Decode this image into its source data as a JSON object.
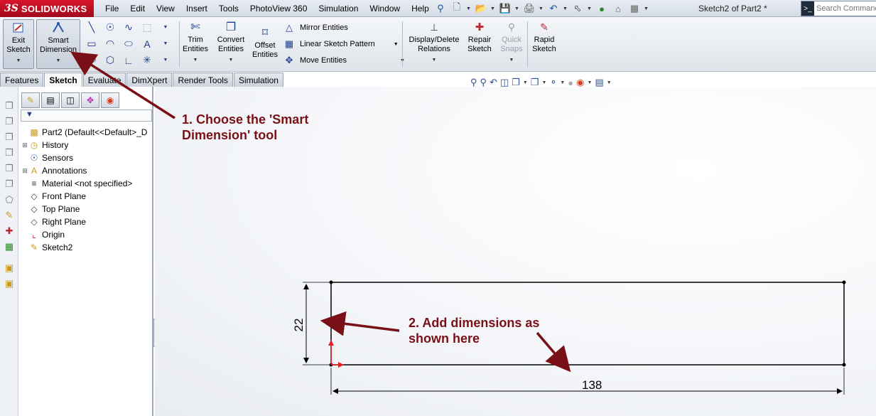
{
  "app": {
    "brand_prefix": "3S",
    "brand": "SOLIDWORKS",
    "doc_title": "Sketch2 of Part2 *"
  },
  "menu": [
    "File",
    "Edit",
    "View",
    "Insert",
    "Tools",
    "PhotoView 360",
    "Simulation",
    "Window",
    "Help"
  ],
  "search": {
    "placeholder": "Search Commands"
  },
  "ribbon": {
    "exit_sketch": [
      "Exit",
      "Sketch"
    ],
    "smart_dimension": [
      "Smart",
      "Dimension"
    ],
    "trim_entities": [
      "Trim",
      "Entities"
    ],
    "convert_entities": [
      "Convert",
      "Entities"
    ],
    "offset_entities": [
      "Offset",
      "Entities"
    ],
    "mirror_entities": "Mirror Entities",
    "linear_sketch_pattern": "Linear Sketch Pattern",
    "move_entities": "Move Entities",
    "display_delete_relations": [
      "Display/Delete",
      "Relations"
    ],
    "repair_sketch": [
      "Repair",
      "Sketch"
    ],
    "quick_snaps": [
      "Quick",
      "Snaps"
    ],
    "rapid_sketch": [
      "Rapid",
      "Sketch"
    ]
  },
  "tabs": [
    "Features",
    "Sketch",
    "Evaluate",
    "DimXpert",
    "Render Tools",
    "Simulation"
  ],
  "active_tab": "Sketch",
  "tree": {
    "root": "Part2  (Default<<Default>_D",
    "items": [
      {
        "label": "History",
        "expandable": true,
        "icon": "history-icon"
      },
      {
        "label": "Sensors",
        "expandable": false,
        "icon": "sensor-icon"
      },
      {
        "label": "Annotations",
        "expandable": true,
        "icon": "annotations-icon"
      },
      {
        "label": "Material <not specified>",
        "expandable": false,
        "icon": "material-icon"
      },
      {
        "label": "Front Plane",
        "expandable": false,
        "icon": "plane-icon"
      },
      {
        "label": "Top Plane",
        "expandable": false,
        "icon": "plane-icon"
      },
      {
        "label": "Right Plane",
        "expandable": false,
        "icon": "plane-icon"
      },
      {
        "label": "Origin",
        "expandable": false,
        "icon": "origin-icon"
      },
      {
        "label": "Sketch2",
        "expandable": false,
        "icon": "sketch-icon"
      }
    ]
  },
  "sketch": {
    "height_dim": "22",
    "width_dim": "138"
  },
  "annotations": {
    "step1": [
      "1. Choose the 'Smart",
      "Dimension' tool"
    ],
    "step2": [
      "2. Add dimensions as",
      "shown here"
    ]
  },
  "colors": {
    "annotation": "#7a1017",
    "brand": "#c8102e"
  }
}
